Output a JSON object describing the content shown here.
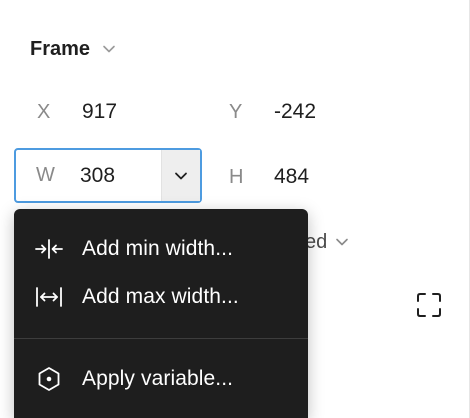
{
  "panel": {
    "title": "Frame",
    "icons": {
      "title_dropdown": "chevron-down-icon",
      "fullscreen": "resize-to-fit-icon"
    }
  },
  "fields": {
    "x": {
      "label": "X",
      "value": "917"
    },
    "y": {
      "label": "Y",
      "value": "-242"
    },
    "w": {
      "label": "W",
      "value": "308"
    },
    "h": {
      "label": "H",
      "value": "484"
    }
  },
  "resizing": {
    "partial_value": "ed"
  },
  "menu": {
    "items": [
      {
        "label": "Add min width...",
        "icon": "min-width-icon"
      },
      {
        "label": "Add max width...",
        "icon": "max-width-icon"
      },
      {
        "label": "Apply variable...",
        "icon": "variable-hexagon-icon"
      }
    ]
  },
  "colors": {
    "focus_border": "#4d9be0",
    "menu_background": "#1e1e1e",
    "label_gray": "#8a8a8a"
  }
}
